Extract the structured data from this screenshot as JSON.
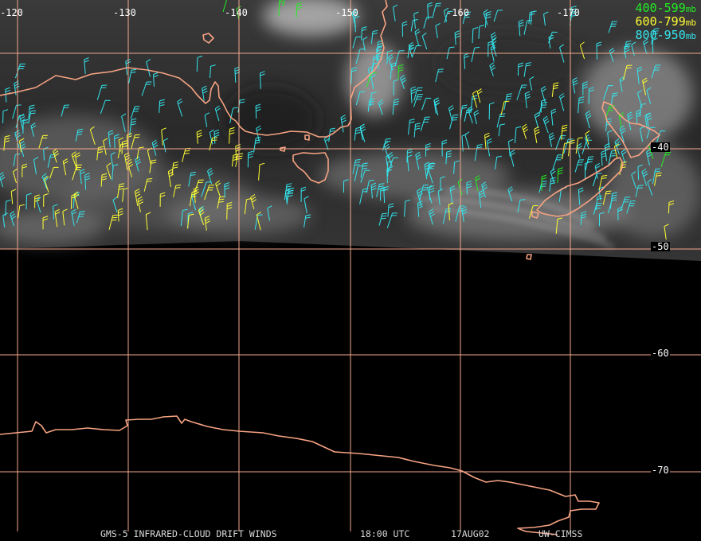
{
  "footer": {
    "product": "GMS-5 INFRARED-CLOUD DRIFT WINDS",
    "time": "18:00 UTC",
    "date": "17AUG02",
    "source": "UW-CIMSS"
  },
  "legend": [
    {
      "range": "400-599",
      "unit": "mb",
      "color": "#22ee22"
    },
    {
      "range": "600-799",
      "unit": "mb",
      "color": "#ffff33"
    },
    {
      "range": "800-950",
      "unit": "mb",
      "color": "#33e6ee"
    }
  ],
  "longitude_labels": [
    "-120",
    "-130",
    "-140",
    "-150",
    "-160",
    "-170"
  ],
  "latitude_labels": [
    "-40",
    "-50",
    "-60",
    "-70"
  ],
  "colors": {
    "gridline": "#f4a98c",
    "coastline": "#f7a383",
    "background": "#000000"
  }
}
